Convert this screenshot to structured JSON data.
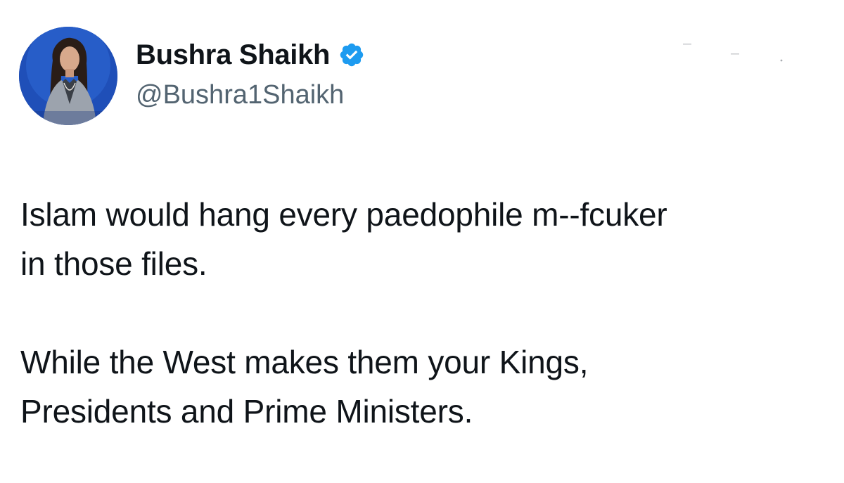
{
  "author": {
    "display_name": "Bushra Shaikh",
    "handle": "@Bushra1Shaikh",
    "verified": true,
    "verified_color": "#1d9bf0"
  },
  "tweet": {
    "paragraph_1_line_1": "Islam would hang every paedophile m--fcuker",
    "paragraph_1_line_2": "in those files.",
    "paragraph_2_line_1": "While the West makes them your Kings,",
    "paragraph_2_line_2": "Presidents and Prime Ministers."
  },
  "icons": {
    "avatar": "profile-photo",
    "badge": "verified-badge-icon",
    "menu": "more-options-icon"
  },
  "colors": {
    "text": "#0f1419",
    "handle": "#536471",
    "background": "#ffffff"
  }
}
